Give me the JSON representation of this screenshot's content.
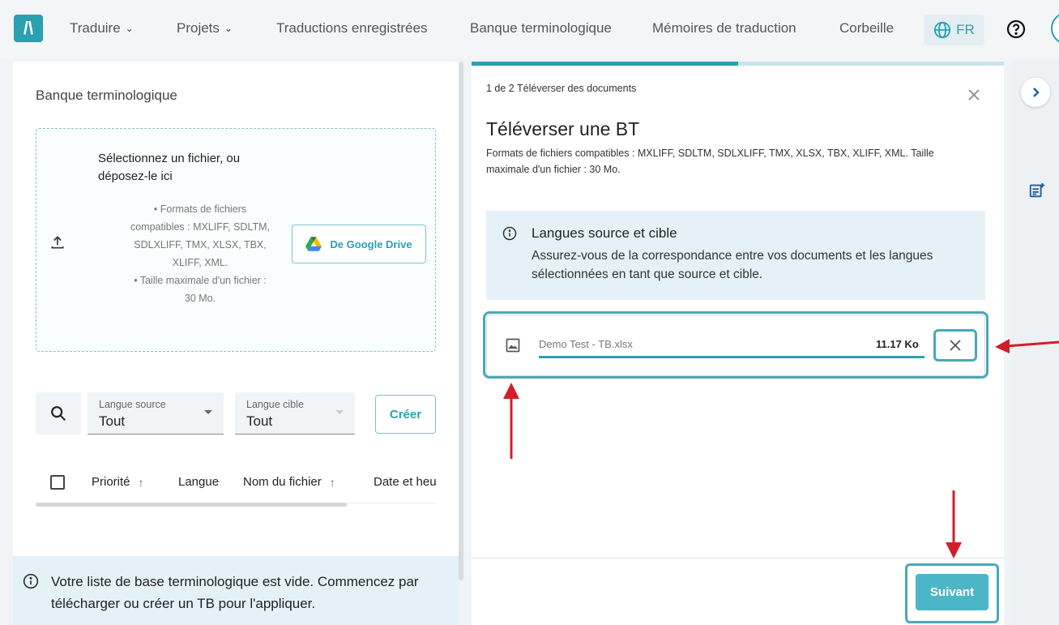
{
  "nav": {
    "logo": "/\\",
    "items": [
      {
        "label": "Traduire",
        "dropdown": true
      },
      {
        "label": "Projets",
        "dropdown": true
      },
      {
        "label": "Traductions enregistrées",
        "dropdown": false
      },
      {
        "label": "Banque terminologique",
        "dropdown": false
      },
      {
        "label": "Mémoires de traduction",
        "dropdown": false
      },
      {
        "label": "Corbeille",
        "dropdown": false
      }
    ],
    "language": "FR"
  },
  "left": {
    "title": "Banque terminologique",
    "dropzone": {
      "title": "Sélectionnez un fichier, ou déposez-le ici",
      "bullets": [
        "Formats de fichiers compatibles : MXLIFF, SDLTM, SDLXLIFF, TMX, XLSX, TBX, XLIFF, XML.",
        "Taille maximale d'un fichier : 30 Mo."
      ],
      "gdrive_label": "De Google Drive"
    },
    "filters": {
      "source_label": "Langue source",
      "source_value": "Tout",
      "target_label": "Langue cible",
      "target_value": "Tout",
      "create_label": "Créer"
    },
    "table": {
      "columns": [
        {
          "label": "Priorité",
          "sort": "↑"
        },
        {
          "label": "Langue",
          "sort": ""
        },
        {
          "label": "Nom du fichier",
          "sort": "↑"
        },
        {
          "label": "Date et heu",
          "sort": ""
        }
      ]
    },
    "empty_message": "Votre liste de base terminologique est vide. Commencez par télécharger ou créer un TB pour l'appliquer."
  },
  "modal": {
    "progress_percent": 50,
    "step": "1 de 2 Téléverser des documents",
    "title": "Téléverser une BT",
    "subtitle": "Formats de fichiers compatibles : MXLIFF, SDLTM, SDLXLIFF, TMX, XLSX, TBX, XLIFF, XML. Taille maximale d'un fichier : 30 Mo.",
    "info": {
      "title": "Langues source et cible",
      "body": "Assurez-vous de la correspondance entre vos documents et les langues sélectionnées en tant que source et cible."
    },
    "file": {
      "name": "Demo Test - TB.xlsx",
      "size": "11.17 Ko",
      "upload_progress": 100
    },
    "next_label": "Suivant"
  },
  "colors": {
    "accent": "#2ba0b0",
    "highlight": "#4aa8b8",
    "arrow": "#d21f28",
    "info_bg": "#e4f2f8"
  }
}
